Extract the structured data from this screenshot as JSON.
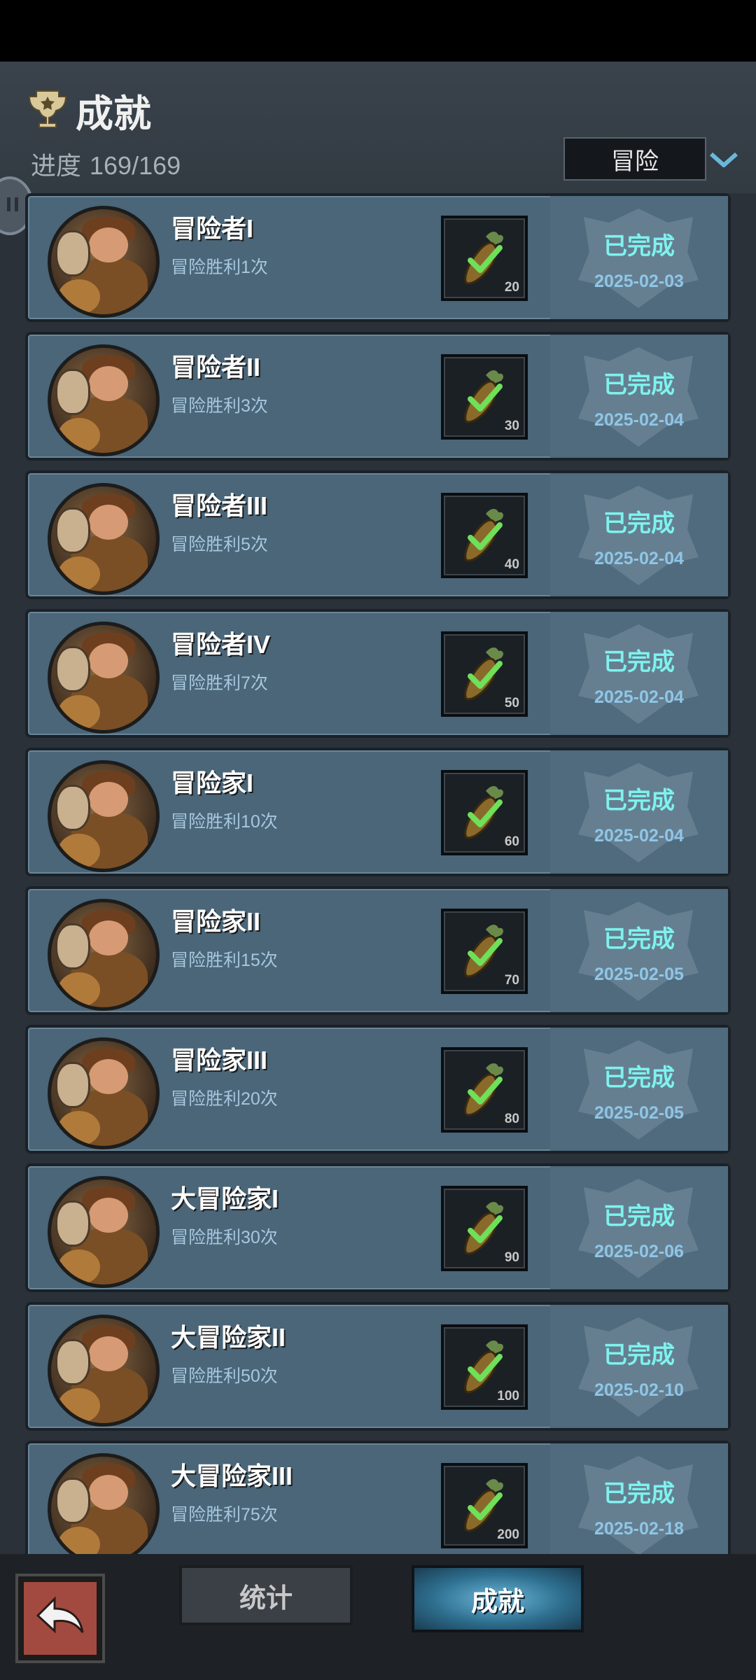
{
  "header": {
    "title": "成就",
    "progress_label": "进度",
    "progress_value": "169/169",
    "filter_selected": "冒险"
  },
  "achievements": [
    {
      "name": "冒险者I",
      "desc": "冒险胜利1次",
      "reward": "20",
      "status": "已完成",
      "date": "2025-02-03"
    },
    {
      "name": "冒险者II",
      "desc": "冒险胜利3次",
      "reward": "30",
      "status": "已完成",
      "date": "2025-02-04"
    },
    {
      "name": "冒险者III",
      "desc": "冒险胜利5次",
      "reward": "40",
      "status": "已完成",
      "date": "2025-02-04"
    },
    {
      "name": "冒险者IV",
      "desc": "冒险胜利7次",
      "reward": "50",
      "status": "已完成",
      "date": "2025-02-04"
    },
    {
      "name": "冒险家I",
      "desc": "冒险胜利10次",
      "reward": "60",
      "status": "已完成",
      "date": "2025-02-04"
    },
    {
      "name": "冒险家II",
      "desc": "冒险胜利15次",
      "reward": "70",
      "status": "已完成",
      "date": "2025-02-05"
    },
    {
      "name": "冒险家III",
      "desc": "冒险胜利20次",
      "reward": "80",
      "status": "已完成",
      "date": "2025-02-05"
    },
    {
      "name": "大冒险家I",
      "desc": "冒险胜利30次",
      "reward": "90",
      "status": "已完成",
      "date": "2025-02-06"
    },
    {
      "name": "大冒险家II",
      "desc": "冒险胜利50次",
      "reward": "100",
      "status": "已完成",
      "date": "2025-02-10"
    },
    {
      "name": "大冒险家III",
      "desc": "冒险胜利75次",
      "reward": "200",
      "status": "已完成",
      "date": "2025-02-18"
    }
  ],
  "tabs": {
    "stats": "统计",
    "achievements": "成就"
  },
  "colors": {
    "card_bg": "#4a6678",
    "status_text": "#7ef2ee",
    "date_text": "#8fc6e8",
    "desc_text": "#a7c7e0"
  },
  "icons": {
    "trophy": "trophy-icon",
    "reward": "carrot-check-icon",
    "dropdown": "chevron-down-icon",
    "back": "back-arrow-icon"
  }
}
